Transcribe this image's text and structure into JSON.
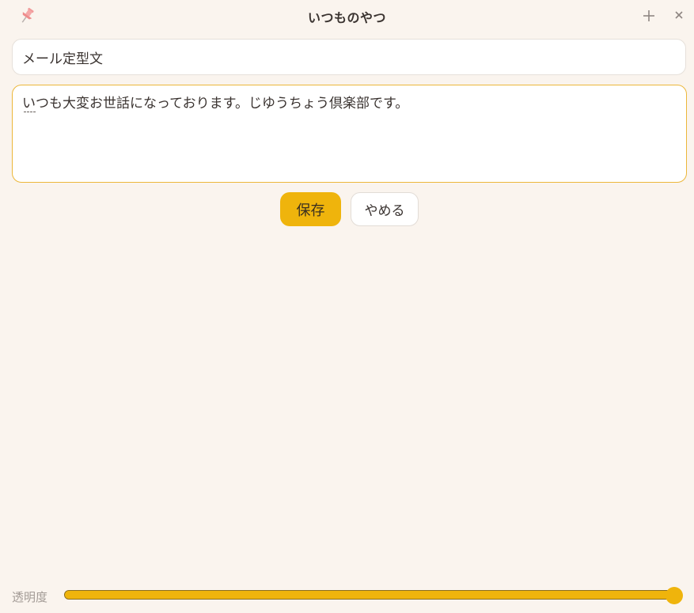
{
  "window": {
    "title": "いつものやつ"
  },
  "icons": {
    "pin": "pushpin-icon",
    "add": "plus-icon",
    "close": "close-icon"
  },
  "form": {
    "title_value": "メール定型文",
    "body_value": "いつも大変お世話になっております。じゆうちょう倶楽部です。",
    "save_label": "保存",
    "cancel_label": "やめる"
  },
  "opacity": {
    "label": "透明度",
    "value_percent": 100
  },
  "colors": {
    "accent": "#efb40c",
    "background": "#faf4ee",
    "focus_border": "#ecb73a"
  }
}
